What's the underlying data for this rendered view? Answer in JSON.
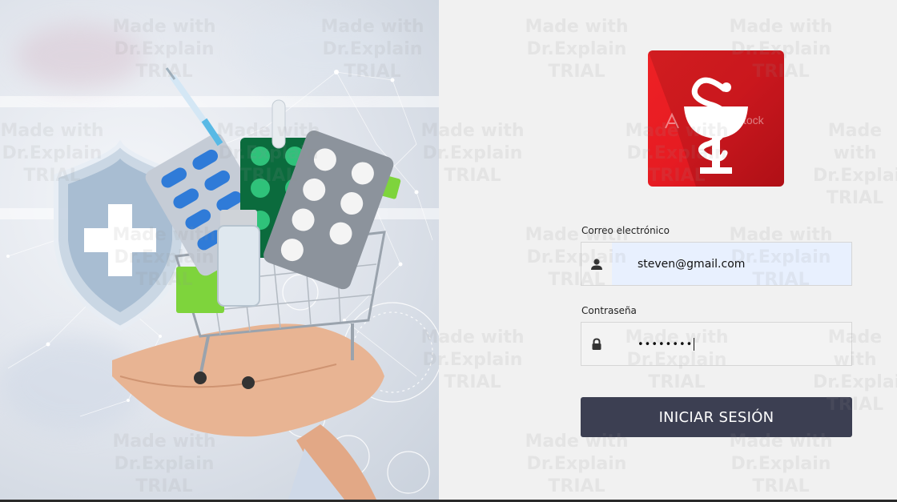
{
  "login": {
    "email_label": "Correo electrónico",
    "email_value": "steven@gmail.com",
    "password_label": "Contraseña",
    "password_value": "••••••••",
    "submit_label": "INICIAR SESIÓN"
  },
  "logo": {
    "watermark_text": "stock"
  },
  "watermark": {
    "line1": "Made with",
    "line2": "Dr.Explain",
    "line3": "TRIAL"
  },
  "colors": {
    "logo_red": "#e61b22",
    "button": "#3c3f52",
    "email_bg": "#e8f0fe"
  },
  "icons": {
    "email_field": "user-icon",
    "password_field": "lock-icon"
  }
}
